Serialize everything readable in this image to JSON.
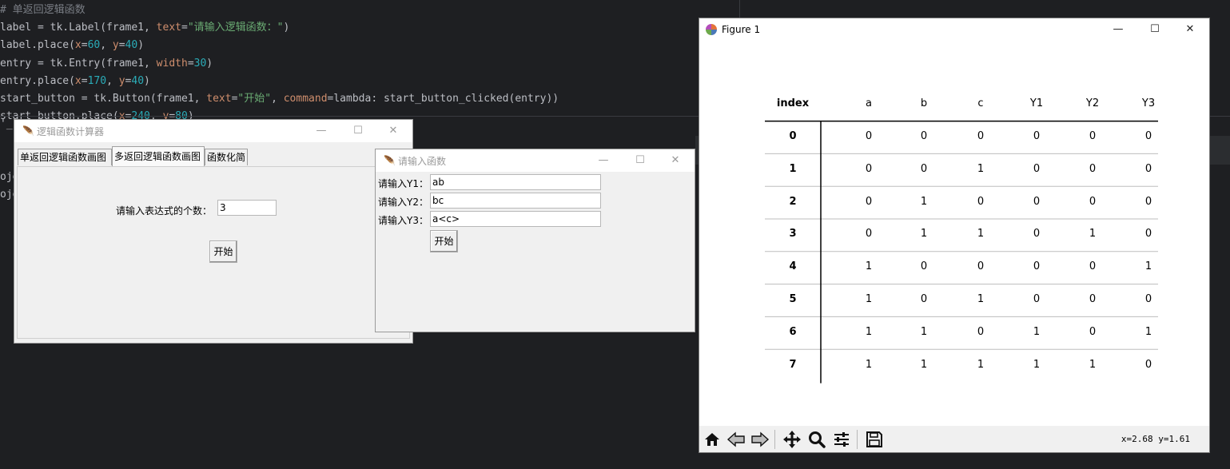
{
  "editor": {
    "lines": [
      [
        {
          "t": "# 单返回逻辑函数",
          "c": "comment"
        }
      ],
      [
        {
          "t": "label = tk.Label(frame1, ",
          "c": ""
        },
        {
          "t": "text",
          "c": "kw"
        },
        {
          "t": "=",
          "c": ""
        },
        {
          "t": "\"请输入逻辑函数：\"",
          "c": "str"
        },
        {
          "t": ")",
          "c": ""
        }
      ],
      [
        {
          "t": "label.place(",
          "c": ""
        },
        {
          "t": "x",
          "c": "kw"
        },
        {
          "t": "=",
          "c": ""
        },
        {
          "t": "60",
          "c": "num"
        },
        {
          "t": ", ",
          "c": ""
        },
        {
          "t": "y",
          "c": "kw"
        },
        {
          "t": "=",
          "c": ""
        },
        {
          "t": "40",
          "c": "num"
        },
        {
          "t": ")",
          "c": ""
        }
      ],
      [
        {
          "t": "entry = tk.Entry(frame1, ",
          "c": ""
        },
        {
          "t": "width",
          "c": "kw"
        },
        {
          "t": "=",
          "c": ""
        },
        {
          "t": "30",
          "c": "num"
        },
        {
          "t": ")",
          "c": ""
        }
      ],
      [
        {
          "t": "entry.place(",
          "c": ""
        },
        {
          "t": "x",
          "c": "kw"
        },
        {
          "t": "=",
          "c": ""
        },
        {
          "t": "170",
          "c": "num"
        },
        {
          "t": ", ",
          "c": ""
        },
        {
          "t": "y",
          "c": "kw"
        },
        {
          "t": "=",
          "c": ""
        },
        {
          "t": "40",
          "c": "num"
        },
        {
          "t": ")",
          "c": ""
        }
      ],
      [
        {
          "t": "start_button = tk.Button(frame1, ",
          "c": ""
        },
        {
          "t": "text",
          "c": "kw"
        },
        {
          "t": "=",
          "c": ""
        },
        {
          "t": "\"开始\"",
          "c": "str"
        },
        {
          "t": ", ",
          "c": ""
        },
        {
          "t": "command",
          "c": "kw"
        },
        {
          "t": "=lambda: start_button_clicked(entry))",
          "c": ""
        }
      ],
      [
        {
          "t": "start_button.place(",
          "c": ""
        },
        {
          "t": "x",
          "c": "kw"
        },
        {
          "t": "=",
          "c": ""
        },
        {
          "t": "240",
          "c": "num"
        },
        {
          "t": ", ",
          "c": ""
        },
        {
          "t": "y",
          "c": "kw"
        },
        {
          "t": "=",
          "c": ""
        },
        {
          "t": "80",
          "c": "num"
        },
        {
          "t": ")",
          "c": ""
        }
      ]
    ],
    "side_fragments": [
      "'_",
      "oje",
      "oje"
    ]
  },
  "window_calculator": {
    "title": "逻辑函数计算器",
    "tabs": [
      "单返回逻辑函数画图",
      "多返回逻辑函数画图",
      "函数化简"
    ],
    "active_tab": 1,
    "count_label": "请输入表达式的个数：",
    "count_value": "3",
    "start_label": "开始"
  },
  "window_input": {
    "title": "请输入函数",
    "rows": [
      {
        "label": "请输入Y1：",
        "value": "ab"
      },
      {
        "label": "请输入Y2：",
        "value": "bc"
      },
      {
        "label": "请输入Y3：",
        "value": "a<c>"
      }
    ],
    "start_label": "开始"
  },
  "figure": {
    "title": "Figure 1",
    "coords": "x=2.68 y=1.61",
    "toolbar": [
      "home-icon",
      "back-arrow-icon",
      "forward-arrow-icon",
      "pan-icon",
      "zoom-icon",
      "configure-icon",
      "save-icon"
    ]
  },
  "chart_data": {
    "type": "table",
    "columns": [
      "index",
      "a",
      "b",
      "c",
      "Y1",
      "Y2",
      "Y3"
    ],
    "rows": [
      [
        "0",
        "0",
        "0",
        "0",
        "0",
        "0",
        "0"
      ],
      [
        "1",
        "0",
        "0",
        "1",
        "0",
        "0",
        "0"
      ],
      [
        "2",
        "0",
        "1",
        "0",
        "0",
        "0",
        "0"
      ],
      [
        "3",
        "0",
        "1",
        "1",
        "0",
        "1",
        "0"
      ],
      [
        "4",
        "1",
        "0",
        "0",
        "0",
        "0",
        "1"
      ],
      [
        "5",
        "1",
        "0",
        "1",
        "0",
        "0",
        "0"
      ],
      [
        "6",
        "1",
        "1",
        "0",
        "1",
        "0",
        "1"
      ],
      [
        "7",
        "1",
        "1",
        "1",
        "1",
        "1",
        "0"
      ]
    ]
  }
}
